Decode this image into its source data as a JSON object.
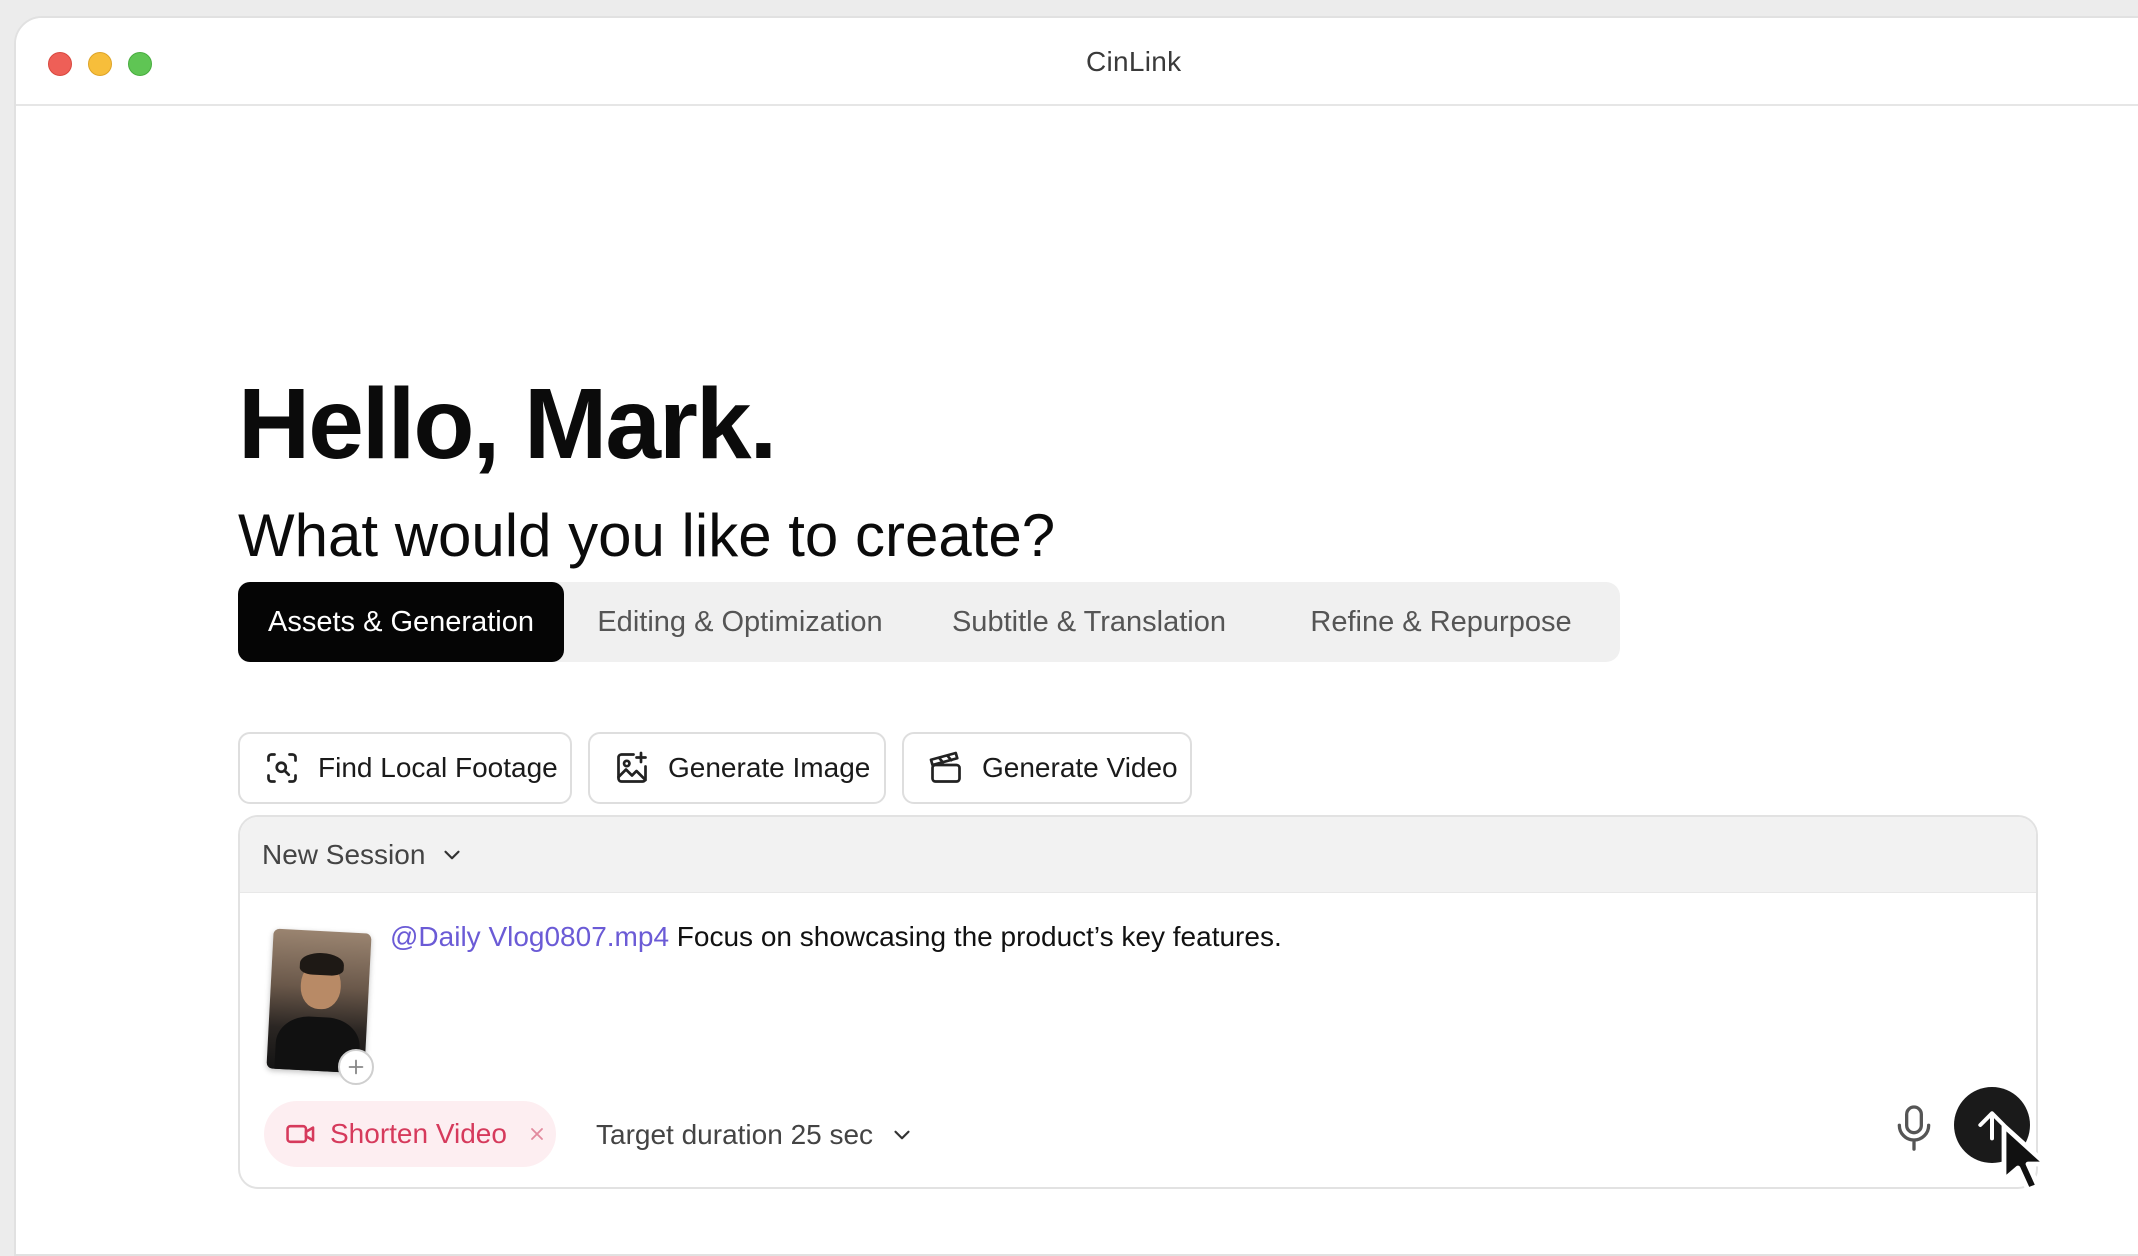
{
  "window": {
    "title": "CinLink"
  },
  "hero": {
    "greeting": "Hello, Mark.",
    "question": "What would you like to create?"
  },
  "tabs": [
    {
      "label": "Assets & Generation",
      "active": true
    },
    {
      "label": "Editing & Optimization",
      "active": false
    },
    {
      "label": "Subtitle & Translation",
      "active": false
    },
    {
      "label": "Refine & Repurpose",
      "active": false
    }
  ],
  "quick_actions": [
    {
      "label": "Find Local Footage",
      "icon": "scan-search-icon"
    },
    {
      "label": "Generate Image",
      "icon": "image-plus-icon"
    },
    {
      "label": "Generate Video",
      "icon": "clapperboard-icon"
    }
  ],
  "composer": {
    "session_label": "New Session",
    "mention": "@Daily Vlog0807.mp4",
    "prompt_text": " Focus on showcasing the product’s key features.",
    "tag_label": "Shorten Video",
    "duration_label": "Target duration 25 sec"
  },
  "colors": {
    "accent_mention": "#6b5bd6",
    "tag_text": "#d63a5c",
    "tag_bg": "#fdeef1",
    "active_tab_bg": "#050505"
  }
}
